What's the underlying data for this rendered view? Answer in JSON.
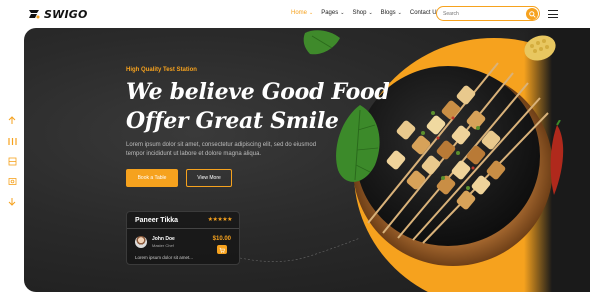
{
  "brand": {
    "name": "SWIGO"
  },
  "nav": [
    {
      "label": "Home",
      "active": true,
      "dropdown": true
    },
    {
      "label": "Pages",
      "active": false,
      "dropdown": true
    },
    {
      "label": "Shop",
      "active": false,
      "dropdown": true
    },
    {
      "label": "Blogs",
      "active": false,
      "dropdown": true
    },
    {
      "label": "Contact Us",
      "active": false,
      "dropdown": false
    }
  ],
  "search": {
    "placeholder": "Search",
    "icon": "search-icon"
  },
  "rail": {
    "icons": [
      "arrow-up-icon",
      "filter-icon",
      "grid-icon",
      "image-icon",
      "arrow-down-icon"
    ]
  },
  "hero": {
    "tagline": "High Quality Test Station",
    "headline_line1": "We believe Good Food",
    "headline_line2": "Offer Great Smile",
    "description": "Lorem ipsum dolor sit amet, consectetur adipiscing elit, sed do eiusmod tempor incididunt ut labore et dolore magna aliqua.",
    "primary_button": "Book a Table",
    "secondary_button": "View More"
  },
  "card": {
    "title": "Paneer Tikka",
    "rating": 5,
    "stars": "★★★★★",
    "chef_name": "John Doe",
    "chef_role": "Master Chef",
    "price": "$10.00",
    "description": "Lorem ipsum dolor sit amet..."
  },
  "colors": {
    "accent": "#f6a21e",
    "dark": "#2a2a2a",
    "text_light": "#ffffff"
  }
}
